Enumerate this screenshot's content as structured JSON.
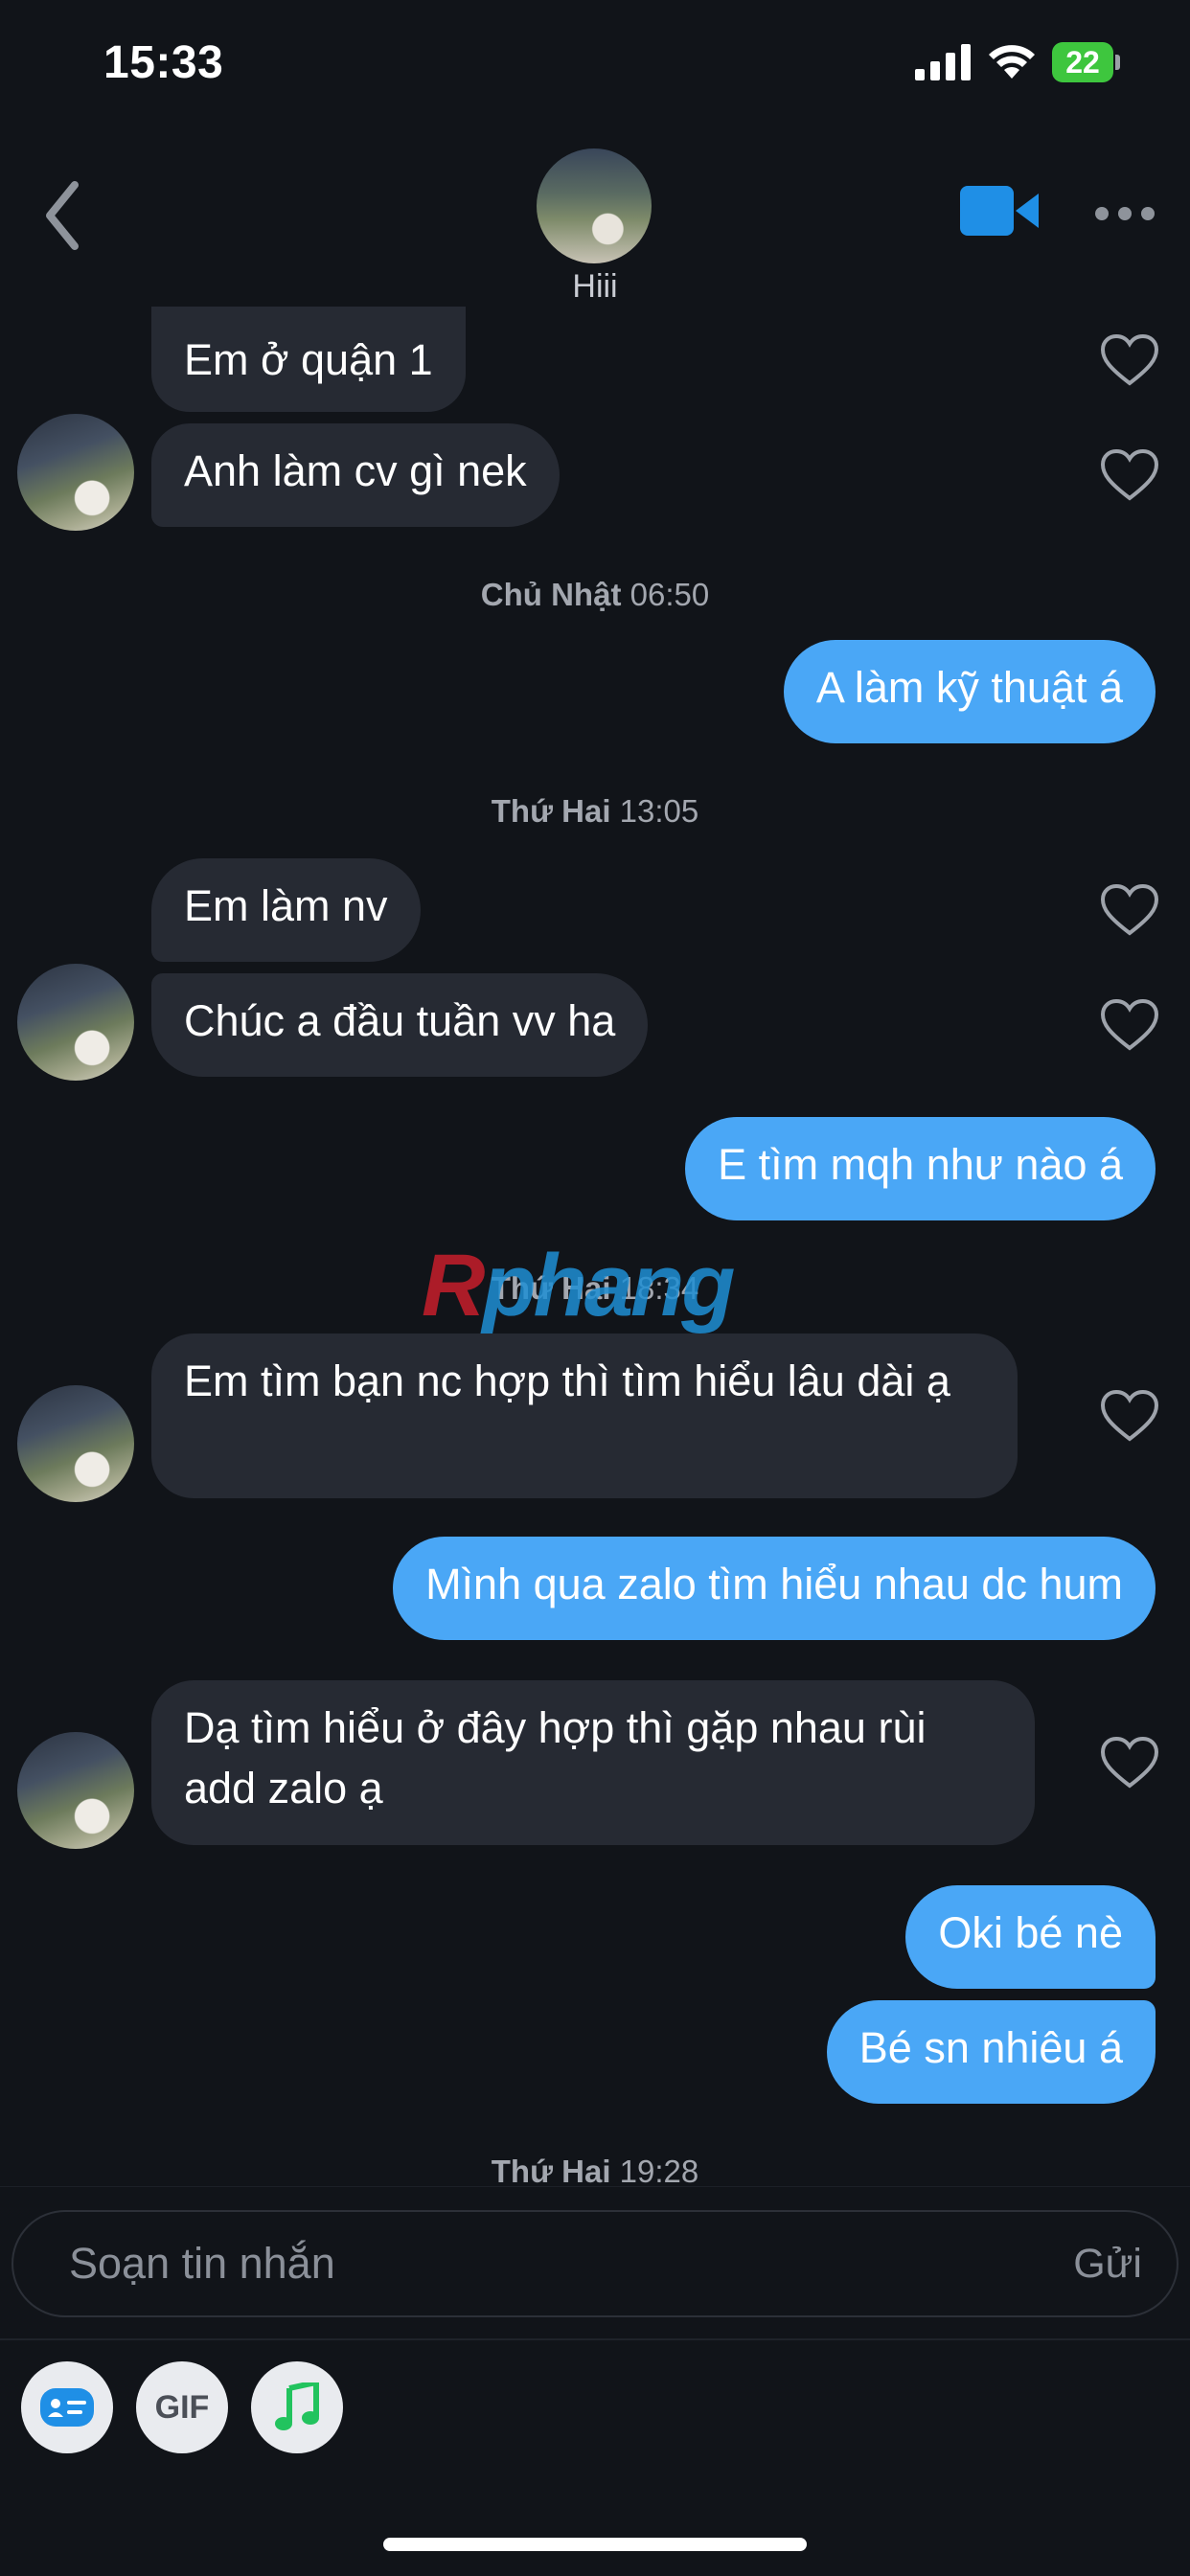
{
  "status_bar": {
    "time": "15:33",
    "battery": "22"
  },
  "header": {
    "contact_name": "Hiii"
  },
  "messages": [
    {
      "side": "in",
      "text": "Em ở quận 1"
    },
    {
      "side": "in",
      "text": "Anh làm cv gì nek"
    },
    {
      "side": "divider",
      "day": "Chủ Nhật",
      "time": "06:50"
    },
    {
      "side": "out",
      "text": "A làm kỹ thuật á"
    },
    {
      "side": "divider",
      "day": "Thứ Hai",
      "time": "13:05"
    },
    {
      "side": "in",
      "text": "Em làm nv"
    },
    {
      "side": "in",
      "text": "Chúc a đầu tuần vv ha"
    },
    {
      "side": "out",
      "text": "E tìm mqh như nào á"
    },
    {
      "side": "divider",
      "day": "Thứ Hai",
      "time": "18:34"
    },
    {
      "side": "in",
      "text": "Em tìm bạn nc hợp thì tìm hiểu lâu dài ạ"
    },
    {
      "side": "out",
      "text": "Mình qua zalo tìm hiểu nhau dc hum"
    },
    {
      "side": "in",
      "text": "Dạ tìm hiểu ở đây hợp thì gặp nhau rùi add zalo ạ"
    },
    {
      "side": "out",
      "text": "Oki bé nè"
    },
    {
      "side": "out",
      "text": "Bé sn nhiêu á"
    },
    {
      "side": "divider",
      "day": "Thứ Hai",
      "time": "19:28"
    }
  ],
  "watermark": {
    "part1": "R",
    "part2": "phang"
  },
  "composer": {
    "placeholder": "Soạn tin nhắn",
    "send_label": "Gửi",
    "gif_label": "GIF"
  },
  "colors": {
    "background": "#111419",
    "incoming_bubble": "#262a33",
    "outgoing_bubble": "#4aa7f6",
    "accent": "#1f8fe6"
  },
  "icons": [
    "signal-icon",
    "wifi-icon",
    "back-icon",
    "video-call-icon",
    "more-icon",
    "heart-icon",
    "contact-card-icon",
    "music-icon"
  ]
}
